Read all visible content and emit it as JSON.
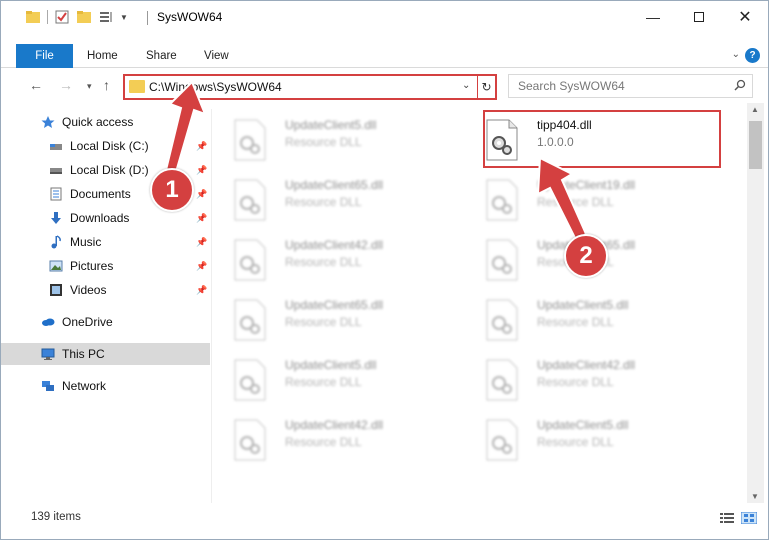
{
  "window": {
    "title": "SysWOW64"
  },
  "ribbon": {
    "tabs": [
      "File",
      "Home",
      "Share",
      "View"
    ]
  },
  "nav": {
    "address": "C:\\Windows\\SysWOW64",
    "search_placeholder": "Search SysWOW64"
  },
  "sidebar": {
    "items": [
      {
        "label": "Quick access",
        "icon": "star-icon",
        "pinned": false
      },
      {
        "label": "Local Disk (C:)",
        "icon": "drive-icon",
        "pinned": true
      },
      {
        "label": "Local Disk (D:)",
        "icon": "drive-icon",
        "pinned": true
      },
      {
        "label": "Documents",
        "icon": "documents-icon",
        "pinned": true
      },
      {
        "label": "Downloads",
        "icon": "download-icon",
        "pinned": true
      },
      {
        "label": "Music",
        "icon": "music-icon",
        "pinned": true
      },
      {
        "label": "Pictures",
        "icon": "pictures-icon",
        "pinned": true
      },
      {
        "label": "Videos",
        "icon": "videos-icon",
        "pinned": true
      },
      {
        "label": "OneDrive",
        "icon": "cloud-icon",
        "pinned": false
      },
      {
        "label": "This PC",
        "icon": "computer-icon",
        "pinned": false,
        "selected": true
      },
      {
        "label": "Network",
        "icon": "network-icon",
        "pinned": false
      }
    ]
  },
  "files": {
    "highlighted": {
      "name": "tipp404.dll",
      "desc": "1.0.0.0"
    },
    "left_column": [
      {
        "name": "UpdateClient5.dll",
        "desc": "Resource DLL"
      },
      {
        "name": "UpdateClient65.dll",
        "desc": "Resource DLL"
      },
      {
        "name": "UpdateClient42.dll",
        "desc": "Resource DLL"
      },
      {
        "name": "UpdateClient65.dll",
        "desc": "Resource DLL"
      },
      {
        "name": "UpdateClient5.dll",
        "desc": "Resource DLL"
      },
      {
        "name": "UpdateClient42.dll",
        "desc": "Resource DLL"
      }
    ],
    "right_column": [
      {
        "name": "UpdateClient19.dll",
        "desc": "Resource DLL"
      },
      {
        "name": "UpdateClient65.dll",
        "desc": "Resource DLL"
      },
      {
        "name": "UpdateClient5.dll",
        "desc": "Resource DLL"
      },
      {
        "name": "UpdateClient42.dll",
        "desc": "Resource DLL"
      },
      {
        "name": "UpdateClient5.dll",
        "desc": "Resource DLL"
      }
    ]
  },
  "status": {
    "count": "139 items"
  },
  "annotations": {
    "step1": "1",
    "step2": "2",
    "color": "#d44040"
  }
}
